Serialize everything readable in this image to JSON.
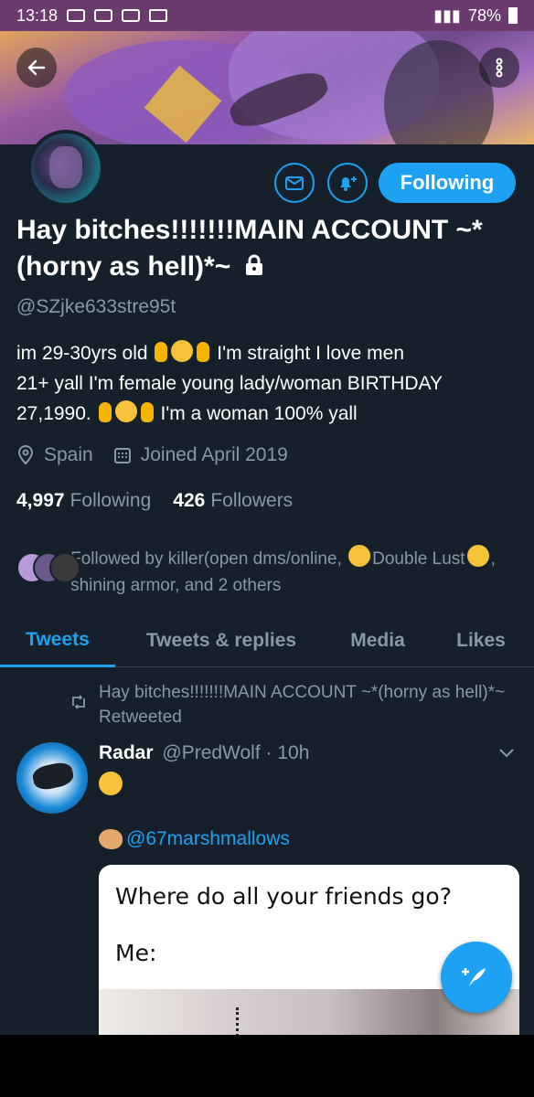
{
  "status_bar": {
    "time": "13:18",
    "battery": "78%"
  },
  "profile": {
    "name": "Hay bitches!!!!!!!MAIN ACCOUNT ~*(horny as hell)*~",
    "handle": "@SZjke633stre95t",
    "bio_line1_a": "im 29-30yrs old",
    "bio_line1_b": "I'm straight I love men",
    "bio_line2": "21+ yall I'm female young lady/woman BIRTHDAY",
    "bio_line3_a": "27,1990.",
    "bio_line3_b": "I'm a woman 100% yall",
    "location": "Spain",
    "joined": "Joined April 2019",
    "following_count": "4,997",
    "following_label": "Following",
    "followers_count": "426",
    "followers_label": "Followers",
    "followed_by_a": "Followed by killer(open dms/online,",
    "followed_by_b": "Double",
    "followed_by_c": "Lust",
    "followed_by_d": ", shining armor, and 2 others",
    "follow_button": "Following"
  },
  "tabs": [
    "Tweets",
    "Tweets & replies",
    "Media",
    "Likes"
  ],
  "tweet": {
    "retweet_context": "Hay bitches!!!!!!!MAIN ACCOUNT ~*(horny as hell)*~ Retweeted",
    "author": "Radar",
    "handle_time": "@PredWolf · 10h",
    "mention": "@67marshmallows",
    "media_line1": "Where do all your friends go?",
    "media_line2": "Me:"
  },
  "colors": {
    "accent": "#1da1f2",
    "background": "#15202b",
    "muted": "#8899a6"
  },
  "icons": [
    "back-arrow-icon",
    "more-vertical-icon",
    "mail-icon",
    "bell-plus-icon",
    "lock-icon",
    "location-pin-icon",
    "calendar-icon",
    "retweet-icon",
    "chevron-down-icon",
    "compose-feather-icon"
  ]
}
